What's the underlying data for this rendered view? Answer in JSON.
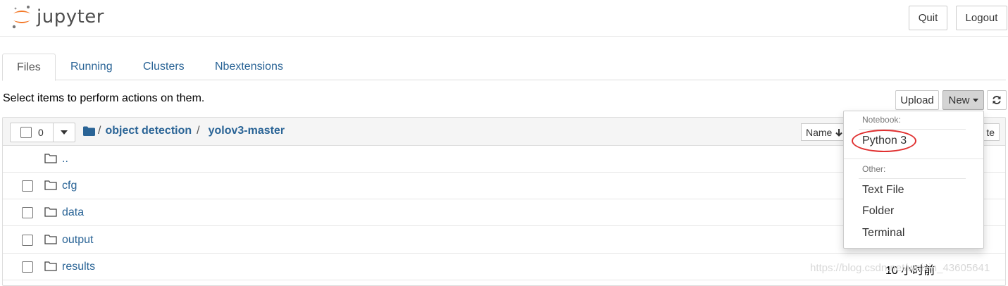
{
  "header": {
    "logo_text": "jupyter",
    "quit_label": "Quit",
    "logout_label": "Logout",
    "brand_color": "#F37726"
  },
  "tabs": [
    {
      "label": "Files",
      "active": true
    },
    {
      "label": "Running",
      "active": false
    },
    {
      "label": "Clusters",
      "active": false
    },
    {
      "label": "Nbextensions",
      "active": false
    }
  ],
  "toolbar": {
    "hint": "Select items to perform actions on them.",
    "upload_label": "Upload",
    "new_label": "New",
    "refresh_icon": "refresh-icon"
  },
  "list_header": {
    "selected_count": "0",
    "breadcrumb": [
      {
        "label": "/"
      },
      {
        "label": "object detection"
      },
      {
        "label": "/"
      },
      {
        "label": "yolov3-master"
      }
    ],
    "sort_name_label": "Name",
    "sort_modified_label": "te"
  },
  "rows": [
    {
      "name": "..",
      "has_checkbox": false,
      "date": ""
    },
    {
      "name": "cfg",
      "has_checkbox": true,
      "date": ""
    },
    {
      "name": "data",
      "has_checkbox": true,
      "date": ""
    },
    {
      "name": "output",
      "has_checkbox": true,
      "date": ""
    },
    {
      "name": "results",
      "has_checkbox": true,
      "date": "10 小时前"
    }
  ],
  "new_menu": {
    "notebook_header": "Notebook:",
    "notebook_items": [
      "Python 3"
    ],
    "other_header": "Other:",
    "other_items": [
      "Text File",
      "Folder",
      "Terminal"
    ],
    "highlight_color": "#e03030"
  },
  "watermark": "https://blog.csdn.net/weixin_43605641"
}
